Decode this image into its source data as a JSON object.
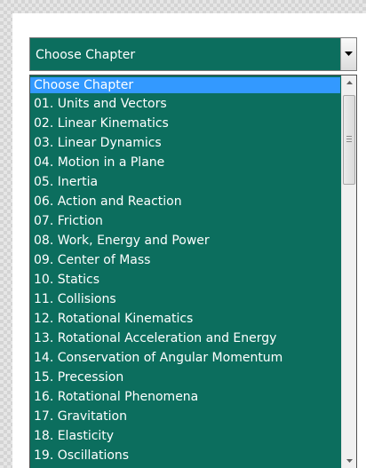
{
  "select": {
    "value": "Choose Chapter"
  },
  "dropdown": {
    "items": [
      "Choose Chapter",
      "01. Units and Vectors",
      "02. Linear Kinematics",
      "03. Linear Dynamics",
      "04. Motion in a Plane",
      "05. Inertia",
      "06. Action and Reaction",
      "07. Friction",
      "08. Work, Energy and Power",
      "09. Center of Mass",
      "10. Statics",
      "11. Collisions",
      "12. Rotational Kinematics",
      "13. Rotational Acceleration and Energy",
      "14. Conservation of Angular Momentum",
      "15. Precession",
      "16. Rotational Phenomena",
      "17. Gravitation",
      "18. Elasticity",
      "19. Oscillations"
    ],
    "selected_index": 0
  },
  "colors": {
    "list_background": "#0c6e5e",
    "selection_highlight": "#3399ff",
    "text": "#ffffff"
  },
  "icons": {
    "select_button": "caret-down-icon",
    "scroll_up": "scroll-up-arrow-icon",
    "scroll_down": "scroll-down-arrow-icon",
    "scroll_thumb_grip": "grip-lines-icon"
  }
}
